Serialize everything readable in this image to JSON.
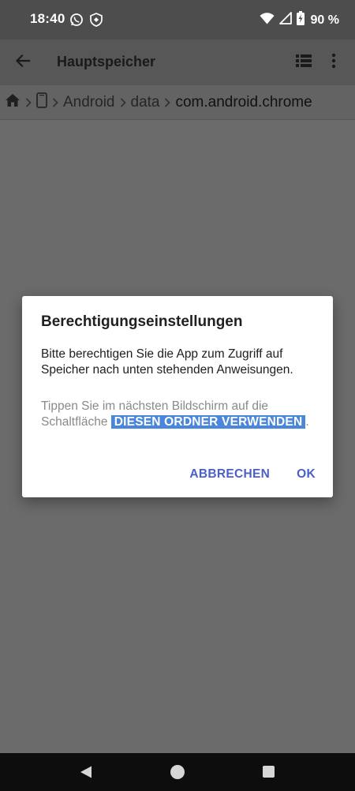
{
  "status_bar": {
    "time": "18:40",
    "left_icons": [
      "whatsapp-icon",
      "shield-icon"
    ],
    "right_icons": [
      "wifi-icon",
      "cell-signal-icon",
      "battery-charging-icon"
    ],
    "battery_text": "90 %"
  },
  "app_bar": {
    "title": "Hauptspeicher",
    "icons": [
      "back-arrow-icon",
      "list-view-icon",
      "more-vert-icon"
    ]
  },
  "breadcrumb": {
    "items": [
      "Android",
      "data",
      "com.android.chrome"
    ],
    "icons": [
      "home-icon",
      "phone-icon"
    ]
  },
  "dialog": {
    "title": "Berechtigungseinstellungen",
    "message": "Bitte berechtigen Sie die App zum Zugriff auf Speicher nach unten stehenden Anweisungen.",
    "instruction_prefix": "Tippen Sie im nächsten Bildschirm auf die Schaltfläche",
    "instruction_highlight": "DIESEN ORDNER VERWENDEN",
    "instruction_suffix": ".",
    "cancel_label": "ABBRECHEN",
    "ok_label": "OK"
  },
  "colors": {
    "status_bar_bg": "#4d4d4d",
    "app_bar_bg": "#575757",
    "scrim_bg": "#6b6b6b",
    "accent": "#4a5fc8",
    "highlight_bg": "#4a86d9"
  },
  "nav_bar": {
    "icons": [
      "nav-back-icon",
      "nav-home-icon",
      "nav-recents-icon"
    ]
  }
}
